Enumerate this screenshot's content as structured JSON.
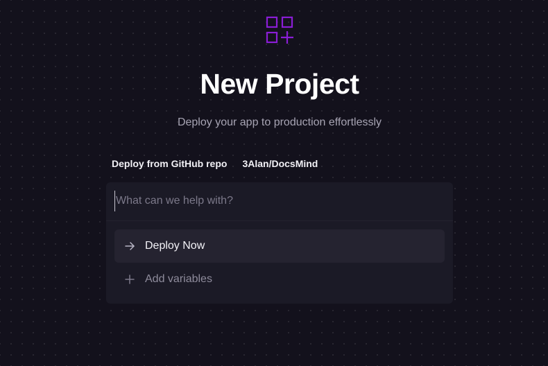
{
  "header": {
    "logo_icon": "grid-plus-icon",
    "title": "New Project",
    "subtitle": "Deploy your app to production effortlessly"
  },
  "source": {
    "label": "Deploy from GitHub repo",
    "repo": "3Alan/DocsMind"
  },
  "prompt": {
    "placeholder": "What can we help with?",
    "value": ""
  },
  "options": [
    {
      "label": "Deploy Now",
      "icon": "arrow-right-icon",
      "highlighted": true
    },
    {
      "label": "Add variables",
      "icon": "plus-icon",
      "highlighted": false
    }
  ],
  "colors": {
    "background": "#13111c",
    "card": "#1b1a26",
    "highlight": "#252330",
    "accent": "#8a1dd6"
  }
}
